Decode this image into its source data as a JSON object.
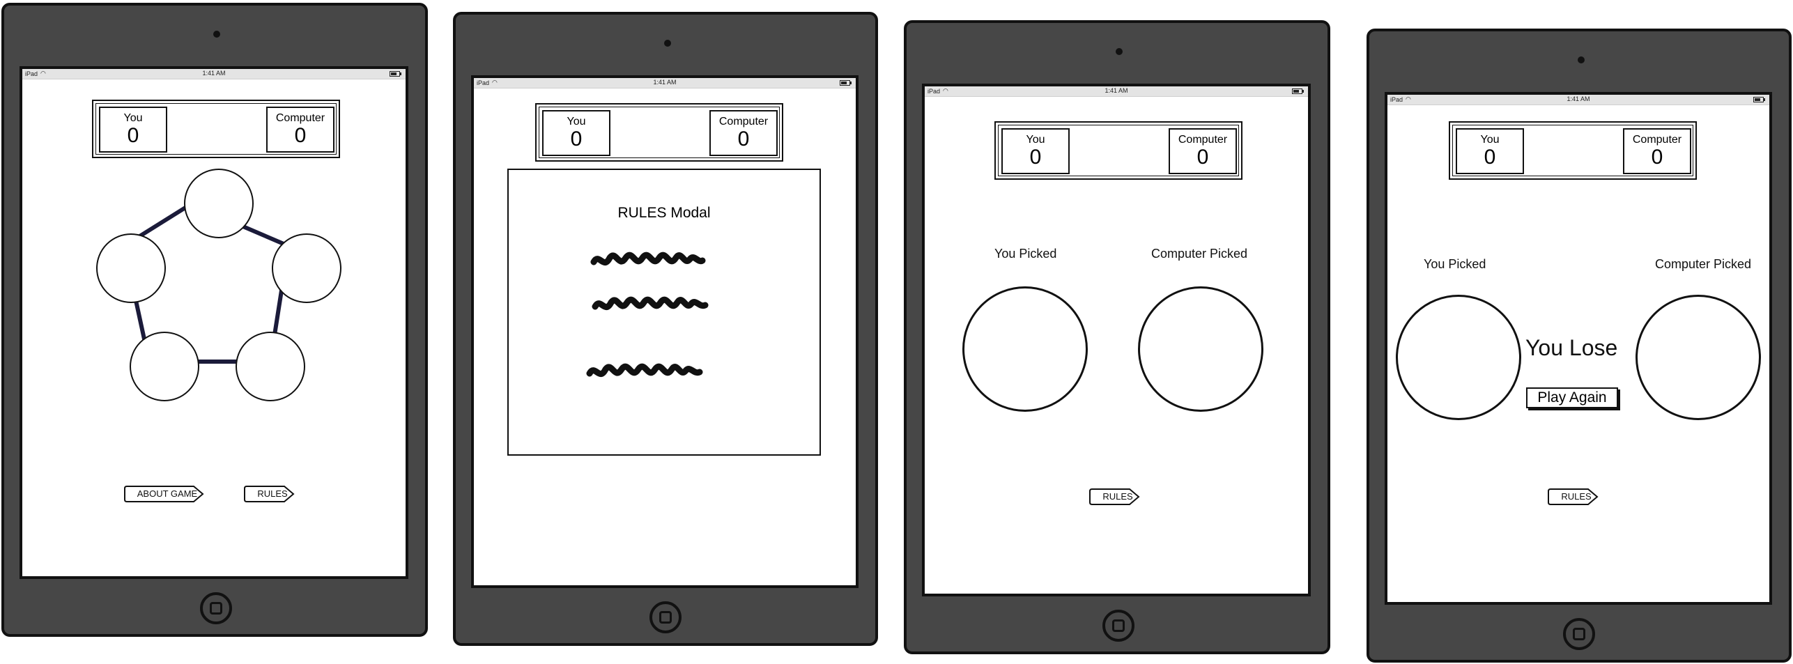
{
  "statusbar": {
    "device": "iPad",
    "time": "1:41 AM"
  },
  "scoreboard": {
    "you_label": "You",
    "you_score": "0",
    "computer_label": "Computer",
    "computer_score": "0"
  },
  "screen1": {
    "about_button": "ABOUT GAME",
    "rules_button": "RULES"
  },
  "screen2": {
    "modal_title": "RULES Modal"
  },
  "screen3": {
    "you_picked": "You Picked",
    "computer_picked": "Computer Picked",
    "rules_button": "RULES"
  },
  "screen4": {
    "you_picked": "You Picked",
    "computer_picked": "Computer Picked",
    "result": "You Lose",
    "play_again": "Play Again",
    "rules_button": "RULES"
  },
  "colors": {
    "device_body": "#474747",
    "connector": "#1b1b3a",
    "outline": "#111111"
  }
}
